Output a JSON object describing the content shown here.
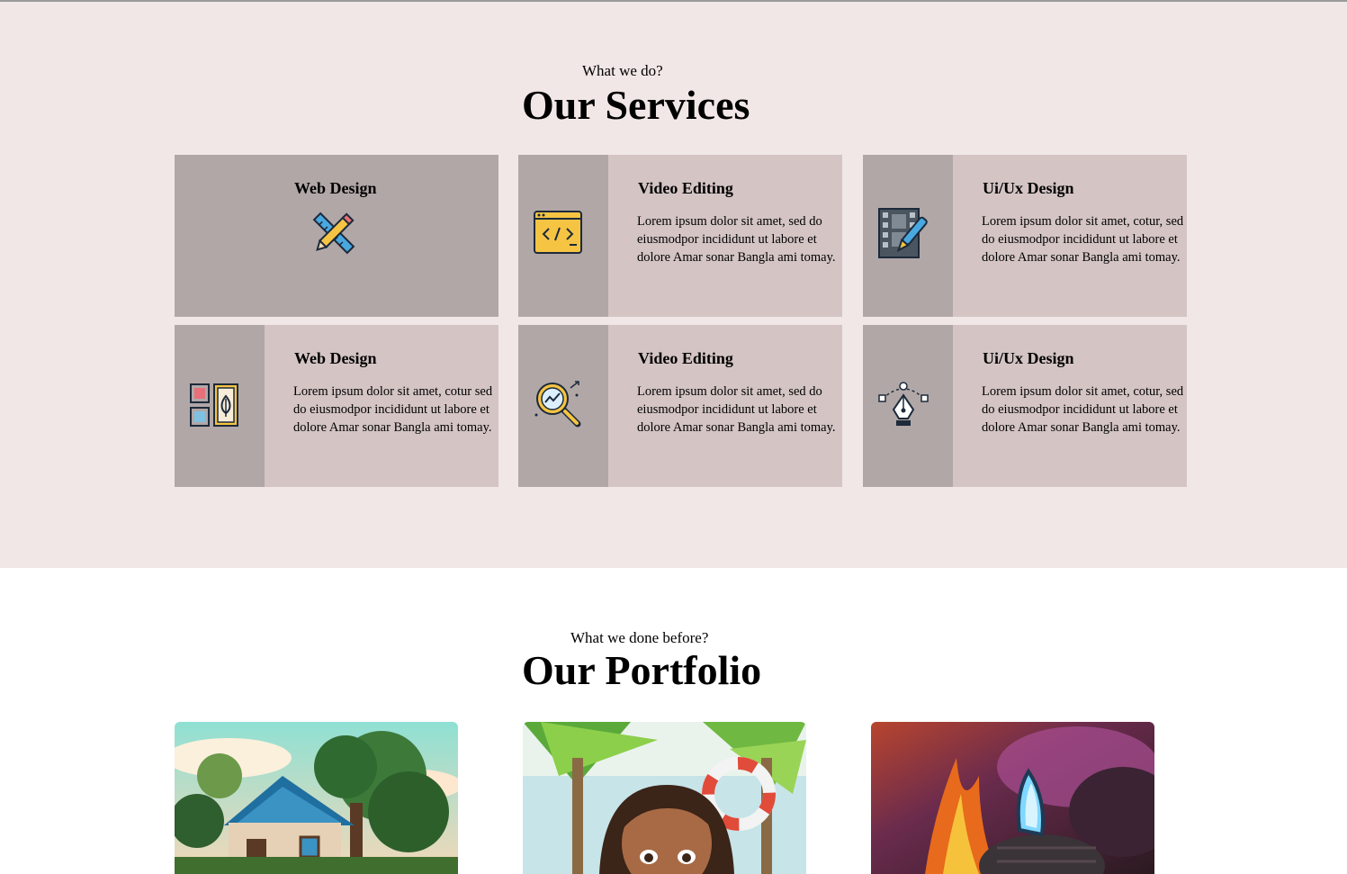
{
  "services": {
    "eyebrow": "What we do?",
    "title": "Our Services",
    "cards": [
      {
        "title": "Web Design",
        "icon": "ruler-pencil-icon"
      },
      {
        "title": "Video Editing",
        "text": "Lorem ipsum dolor sit amet, sed do eiusmodpor incididunt ut labore et dolore Amar sonar Bangla ami tomay.",
        "icon": "code-window-icon"
      },
      {
        "title": "Ui/Ux Design",
        "text": "Lorem ipsum dolor sit amet, cotur, sed do eiusmodpor incididunt ut labore et dolore Amar sonar Bangla ami tomay.",
        "icon": "film-brush-icon"
      },
      {
        "title": "Web Design",
        "text": "Lorem ipsum dolor sit amet, cotur sed do eiusmodpor incididunt ut labore et dolore Amar sonar Bangla ami tomay.",
        "icon": "layout-grid-icon"
      },
      {
        "title": "Video Editing",
        "text": "Lorem ipsum dolor sit amet, sed do eiusmodpor incididunt ut labore et dolore Amar sonar Bangla ami tomay.",
        "icon": "magnifier-analytics-icon"
      },
      {
        "title": "Ui/Ux Design",
        "text": "Lorem ipsum dolor sit amet, cotur, sed do eiusmodpor incididunt ut labore et dolore Amar sonar Bangla ami tomay.",
        "icon": "pen-tool-icon"
      }
    ]
  },
  "portfolio": {
    "eyebrow": "What we done before?",
    "title": "Our Portfolio",
    "items": [
      {
        "image": "cottage-illustration"
      },
      {
        "image": "beach-girl-illustration"
      },
      {
        "image": "fire-explosion-illustration"
      }
    ]
  },
  "colors": {
    "services_bg": "#f1e7e6",
    "card_light": "#d4c5c4",
    "card_dark": "#b1a7a7"
  }
}
